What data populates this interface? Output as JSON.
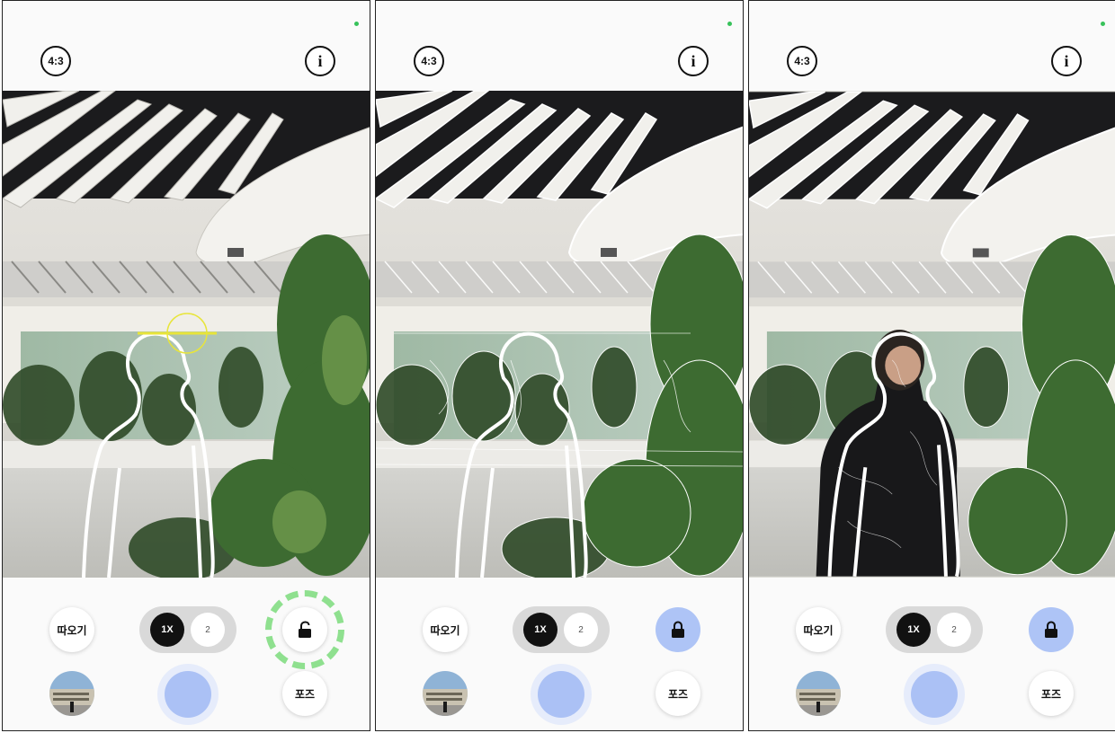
{
  "screens": [
    {
      "ratio_label": "4:3",
      "info_label": "i",
      "cutout_label": "따오기",
      "zoom": {
        "active": "1X",
        "alt": "2"
      },
      "lock": {
        "state": "unlocked",
        "highlight": "dashed-ring"
      },
      "pose_label": "포즈",
      "overlay": {
        "edge_map": false,
        "person": false
      }
    },
    {
      "ratio_label": "4:3",
      "info_label": "i",
      "cutout_label": "따오기",
      "zoom": {
        "active": "1X",
        "alt": "2"
      },
      "lock": {
        "state": "locked",
        "highlight": "none"
      },
      "pose_label": "포즈",
      "overlay": {
        "edge_map": true,
        "person": false
      }
    },
    {
      "ratio_label": "4:3",
      "info_label": "i",
      "cutout_label": "따오기",
      "zoom": {
        "active": "1X",
        "alt": "2"
      },
      "lock": {
        "state": "locked",
        "highlight": "none"
      },
      "pose_label": "포즈",
      "overlay": {
        "edge_map": true,
        "person": true
      }
    }
  ],
  "colors": {
    "status_dot": "#37c25a",
    "lock_active": "#aec4f6",
    "shutter_inner": "#abc1f5",
    "shutter_outer": "#e6ecfb",
    "focus_ring": "#8fe08f",
    "guide_marker": "#e8e53a"
  },
  "icons": [
    "lock-open-icon",
    "lock-closed-icon",
    "info-icon",
    "aspect-ratio-icon"
  ]
}
